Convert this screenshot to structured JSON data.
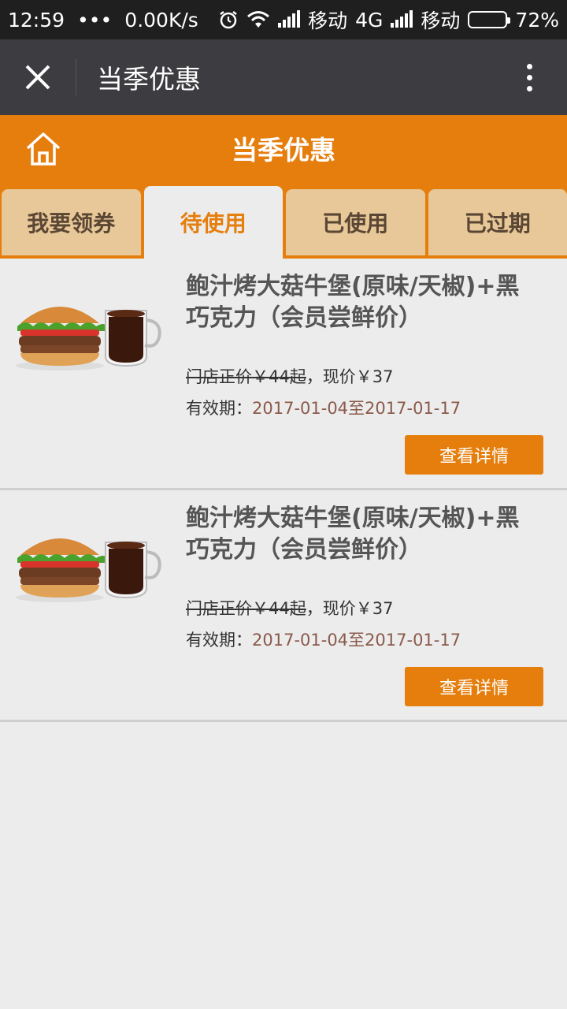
{
  "status_bar": {
    "time": "12:59",
    "dots": "•••",
    "speed": "0.00K/s",
    "carrier1": "移动",
    "network": "4G",
    "carrier2": "移动",
    "battery": "72%",
    "battery_level": 0.72
  },
  "title_bar": {
    "title": "当季优惠"
  },
  "header": {
    "title": "当季优惠"
  },
  "tabs": [
    {
      "label": "我要领券",
      "active": false
    },
    {
      "label": "待使用",
      "active": true
    },
    {
      "label": "已使用",
      "active": false
    },
    {
      "label": "已过期",
      "active": false
    }
  ],
  "coupons": [
    {
      "name": "鲍汁烤大菇牛堡(原味/天椒)+黑巧克力（会员尝鲜价）",
      "orig_price": "门店正价￥44起",
      "sep": "，",
      "current_price": "现价￥37",
      "validity_label": "有效期：",
      "validity_dates": "2017-01-04至2017-01-17",
      "button": "查看详情"
    },
    {
      "name": "鲍汁烤大菇牛堡(原味/天椒)+黑巧克力（会员尝鲜价）",
      "orig_price": "门店正价￥44起",
      "sep": "，",
      "current_price": "现价￥37",
      "validity_label": "有效期：",
      "validity_dates": "2017-01-04至2017-01-17",
      "button": "查看详情"
    }
  ],
  "colors": {
    "accent": "#e57e0d",
    "tab_inactive": "#e8c898",
    "title_bar": "#3d3d41"
  }
}
